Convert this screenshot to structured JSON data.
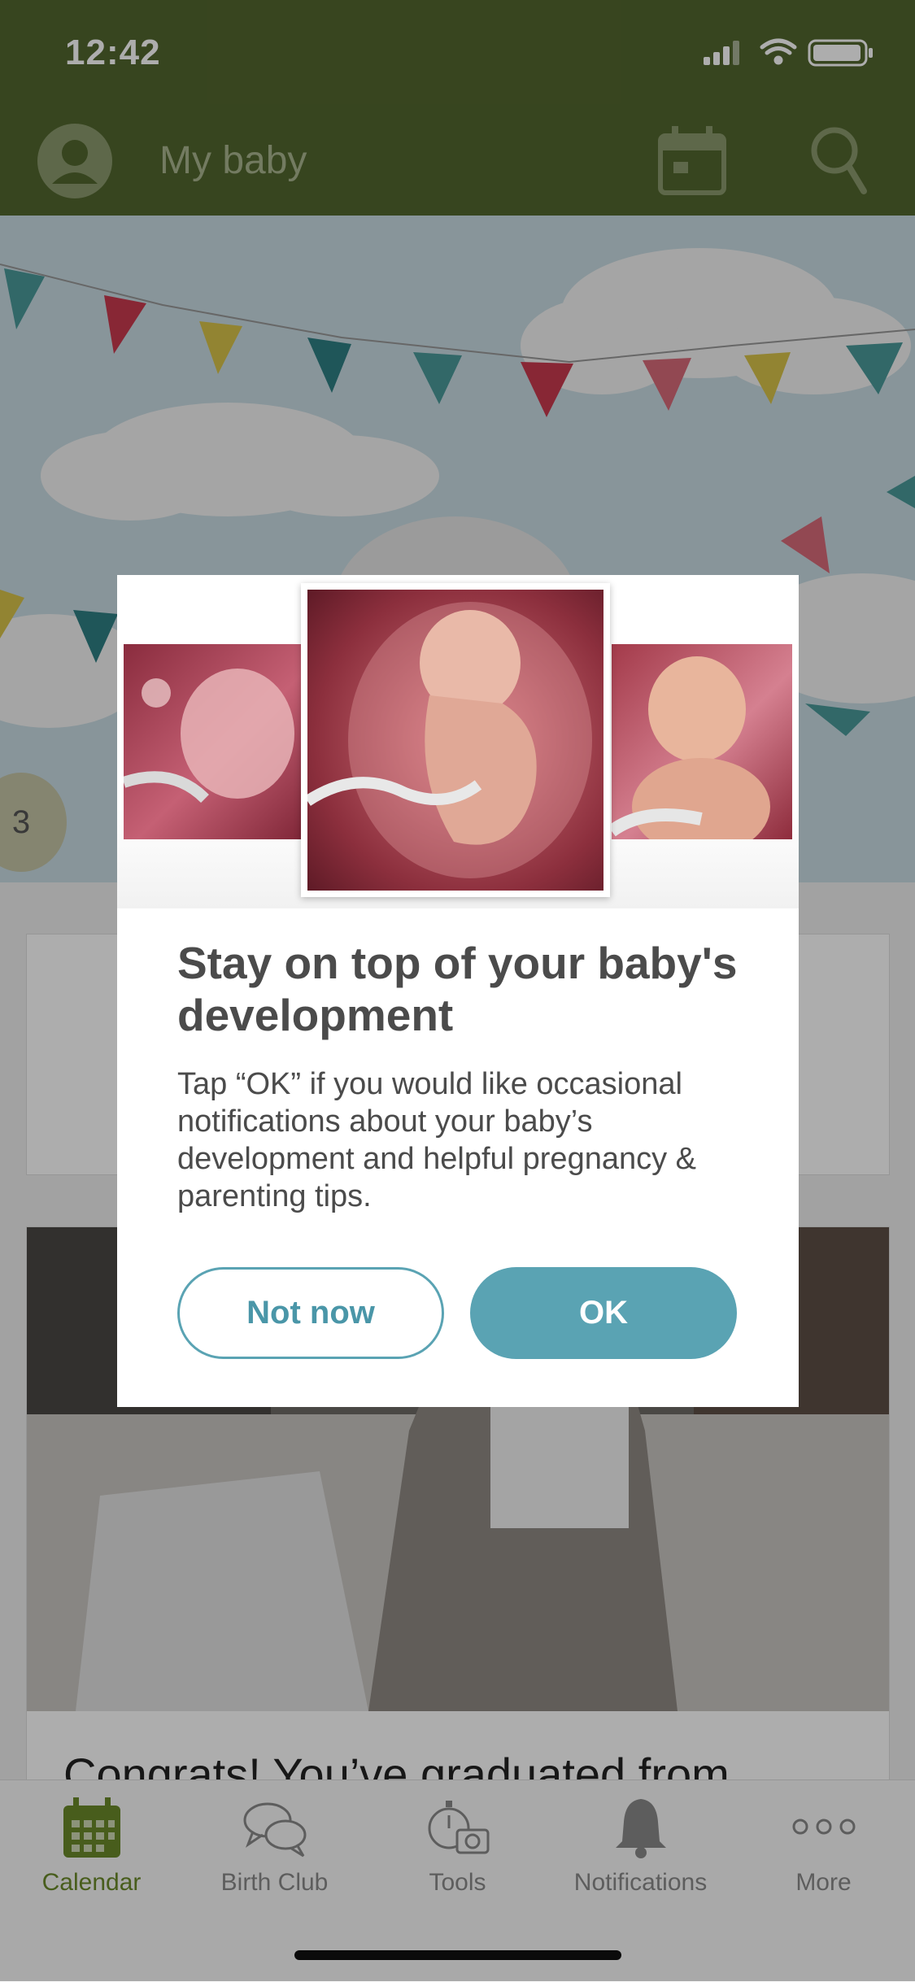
{
  "status_bar": {
    "time": "12:42"
  },
  "header": {
    "title": "My baby"
  },
  "hero": {
    "week_number": "3"
  },
  "feed": {
    "card_title": "Congrats! You’ve graduated from"
  },
  "dialog": {
    "title": "Stay on top of your baby's development",
    "body": "Tap “OK” if you would like occasional notifications about your baby’s development and helpful pregnancy & parenting tips.",
    "not_now_label": "Not now",
    "ok_label": "OK"
  },
  "tabbar": {
    "tabs": [
      {
        "label": "Calendar",
        "icon": "calendar-icon",
        "active": true
      },
      {
        "label": "Birth Club",
        "icon": "chat-bubbles-icon",
        "active": false
      },
      {
        "label": "Tools",
        "icon": "tools-icon",
        "active": false
      },
      {
        "label": "Notifications",
        "icon": "bell-icon",
        "active": false
      },
      {
        "label": "More",
        "icon": "more-dots-icon",
        "active": false
      }
    ]
  },
  "colors": {
    "brand_green": "#52662e",
    "accent_teal": "#5aa3b3",
    "active_tab": "#6a8a2a"
  }
}
